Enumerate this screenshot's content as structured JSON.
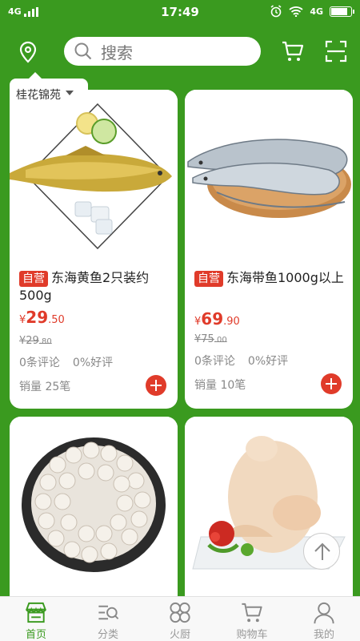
{
  "status": {
    "network_left": "4G",
    "time": "17:49",
    "network_right": "4G"
  },
  "header": {
    "search_placeholder": "搜索",
    "location": "桂花锦苑"
  },
  "products": [
    {
      "tag": "自营",
      "name": "东海黄鱼2只装约500g",
      "price_int": "29",
      "price_dec": ".50",
      "old_int": "29",
      "old_dec": ".80",
      "reviews": "0条评论",
      "good_rate": "0%好评",
      "sales": "销量 25笔"
    },
    {
      "tag": "自营",
      "name": "东海带鱼1000g以上",
      "price_int": "69",
      "price_dec": ".90",
      "old_int": "75",
      "old_dec": ".00",
      "reviews": "0条评论",
      "good_rate": "0%好评",
      "sales": "销量 10笔"
    }
  ],
  "currency": "¥",
  "tabs": [
    {
      "label": "首页",
      "icon": "home-store-icon",
      "active": true
    },
    {
      "label": "分类",
      "icon": "category-icon",
      "active": false
    },
    {
      "label": "火厨",
      "icon": "kitchen-icon",
      "active": false
    },
    {
      "label": "购物车",
      "icon": "cart-icon",
      "active": false
    },
    {
      "label": "我的",
      "icon": "profile-icon",
      "active": false
    }
  ],
  "colors": {
    "brand_green": "#3a9a1f",
    "price_red": "#e03b2a"
  }
}
